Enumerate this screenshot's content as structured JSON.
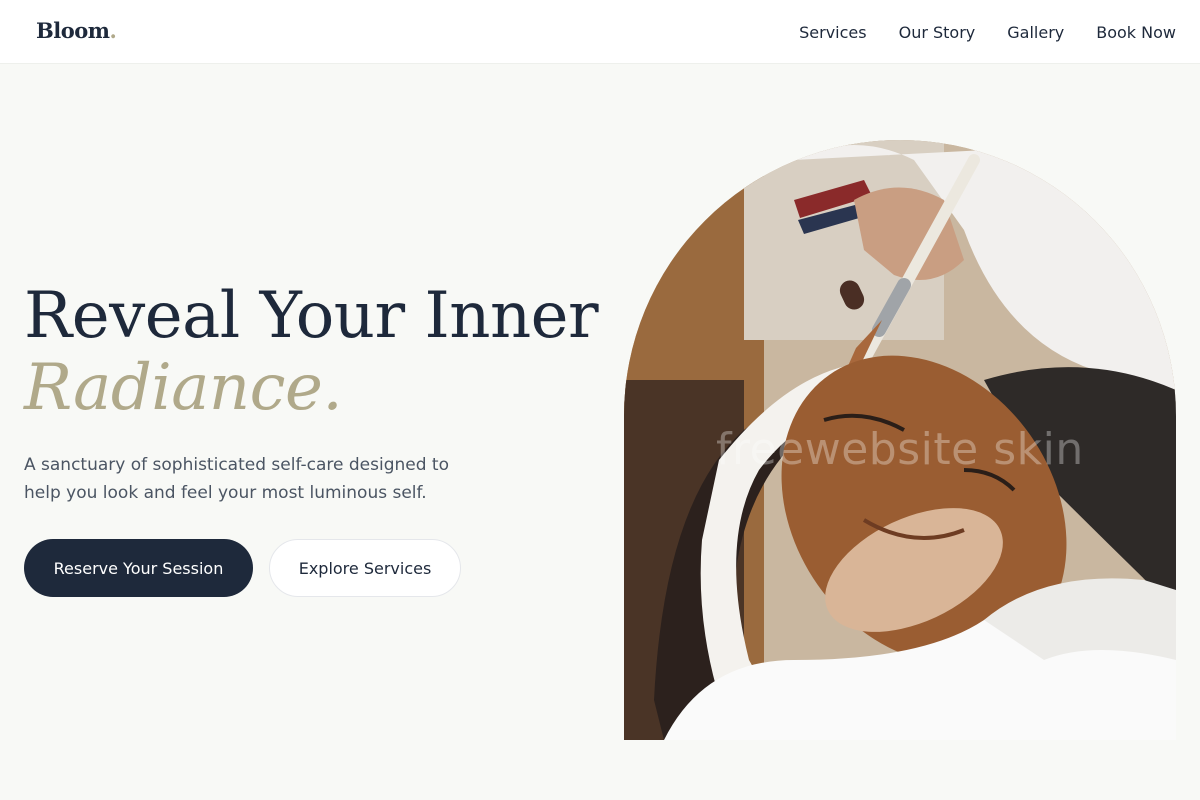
{
  "header": {
    "logo": "Bloom",
    "logo_dot": ".",
    "nav": [
      "Services",
      "Our Story",
      "Gallery",
      "Book Now"
    ]
  },
  "hero": {
    "headline_line1": "Reveal Your Inner",
    "headline_line2": "Radiance.",
    "subtext": "A sanctuary of sophisticated self-care designed to help you look and feel your most luminous self.",
    "primary_cta": "Reserve Your Session",
    "secondary_cta": "Explore Services"
  },
  "image": {
    "watermark": "freewebsite skin"
  },
  "colors": {
    "primary": "#1e293b",
    "accent": "#b0a98a",
    "background": "#f8f9f6"
  }
}
